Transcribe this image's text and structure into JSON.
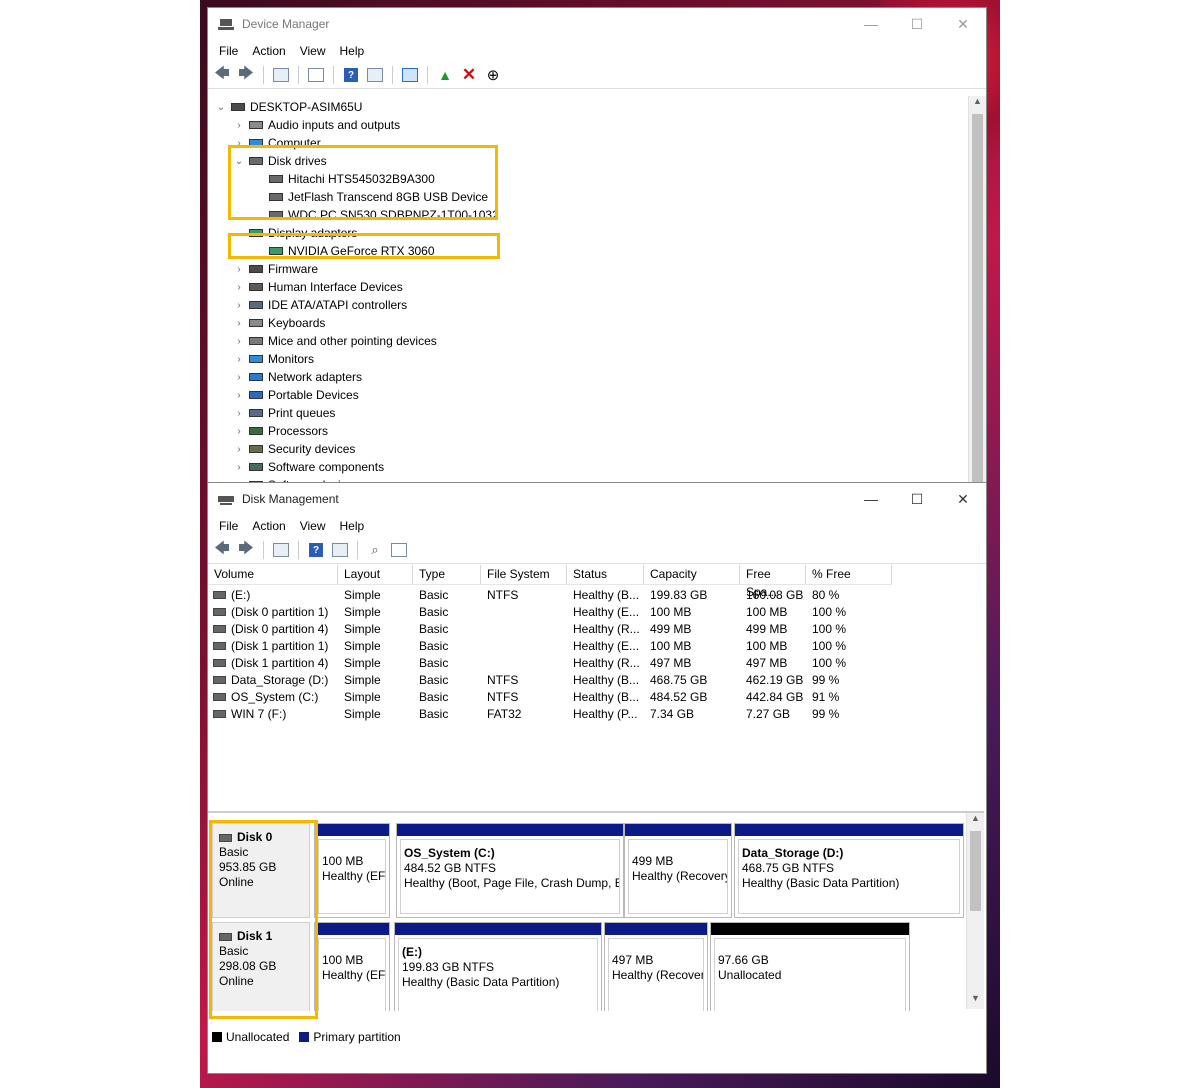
{
  "device_manager": {
    "title": "Device Manager",
    "menu": [
      "File",
      "Action",
      "View",
      "Help"
    ],
    "window_controls": {
      "minimize": "—",
      "maximize": "☐",
      "close": "✕"
    },
    "tree": [
      {
        "label": "DESKTOP-ASIM65U",
        "level": 0,
        "expander": "⌄",
        "icon": "computer-root-icon"
      },
      {
        "label": "Audio inputs and outputs",
        "level": 1,
        "expander": "›",
        "icon": "speaker-icon"
      },
      {
        "label": "Computer",
        "level": 1,
        "expander": "›",
        "icon": "monitor-icon"
      },
      {
        "label": "Disk drives",
        "level": 1,
        "expander": "⌄",
        "icon": "disk-drive-icon"
      },
      {
        "label": "Hitachi HTS545032B9A300",
        "level": 2,
        "expander": "",
        "icon": "disk-drive-icon"
      },
      {
        "label": "JetFlash Transcend 8GB USB Device",
        "level": 2,
        "expander": "",
        "icon": "disk-drive-icon"
      },
      {
        "label": "WDC PC SN530 SDBPNPZ-1T00-1032",
        "level": 2,
        "expander": "",
        "icon": "disk-drive-icon"
      },
      {
        "label": "Display adapters",
        "level": 1,
        "expander": "⌄",
        "icon": "display-adapter-icon"
      },
      {
        "label": "NVIDIA GeForce RTX 3060",
        "level": 2,
        "expander": "",
        "icon": "display-adapter-icon"
      },
      {
        "label": "Firmware",
        "level": 1,
        "expander": "›",
        "icon": "chip-icon"
      },
      {
        "label": "Human Interface Devices",
        "level": 1,
        "expander": "›",
        "icon": "hid-icon"
      },
      {
        "label": "IDE ATA/ATAPI controllers",
        "level": 1,
        "expander": "›",
        "icon": "ide-controller-icon"
      },
      {
        "label": "Keyboards",
        "level": 1,
        "expander": "›",
        "icon": "keyboard-icon"
      },
      {
        "label": "Mice and other pointing devices",
        "level": 1,
        "expander": "›",
        "icon": "mouse-icon"
      },
      {
        "label": "Monitors",
        "level": 1,
        "expander": "›",
        "icon": "monitor-icon"
      },
      {
        "label": "Network adapters",
        "level": 1,
        "expander": "›",
        "icon": "network-adapter-icon"
      },
      {
        "label": "Portable Devices",
        "level": 1,
        "expander": "›",
        "icon": "portable-device-icon"
      },
      {
        "label": "Print queues",
        "level": 1,
        "expander": "›",
        "icon": "printer-icon"
      },
      {
        "label": "Processors",
        "level": 1,
        "expander": "›",
        "icon": "processor-icon"
      },
      {
        "label": "Security devices",
        "level": 1,
        "expander": "›",
        "icon": "security-device-icon"
      },
      {
        "label": "Software components",
        "level": 1,
        "expander": "›",
        "icon": "software-component-icon"
      },
      {
        "label": "Software devices",
        "level": 1,
        "expander": "›",
        "icon": "software-device-icon"
      }
    ]
  },
  "disk_management": {
    "title": "Disk Management",
    "menu": [
      "File",
      "Action",
      "View",
      "Help"
    ],
    "window_controls": {
      "minimize": "—",
      "maximize": "☐",
      "close": "✕"
    },
    "columns": [
      "Volume",
      "Layout",
      "Type",
      "File System",
      "Status",
      "Capacity",
      "Free Spa...",
      "% Free"
    ],
    "volumes": [
      {
        "volume": "(E:)",
        "layout": "Simple",
        "type": "Basic",
        "fs": "NTFS",
        "status": "Healthy (B...",
        "capacity": "199.83 GB",
        "free": "160.08 GB",
        "pct": "80 %"
      },
      {
        "volume": "(Disk 0 partition 1)",
        "layout": "Simple",
        "type": "Basic",
        "fs": "",
        "status": "Healthy (E...",
        "capacity": "100 MB",
        "free": "100 MB",
        "pct": "100 %"
      },
      {
        "volume": "(Disk 0 partition 4)",
        "layout": "Simple",
        "type": "Basic",
        "fs": "",
        "status": "Healthy (R...",
        "capacity": "499 MB",
        "free": "499 MB",
        "pct": "100 %"
      },
      {
        "volume": "(Disk 1 partition 1)",
        "layout": "Simple",
        "type": "Basic",
        "fs": "",
        "status": "Healthy (E...",
        "capacity": "100 MB",
        "free": "100 MB",
        "pct": "100 %"
      },
      {
        "volume": "(Disk 1 partition 4)",
        "layout": "Simple",
        "type": "Basic",
        "fs": "",
        "status": "Healthy (R...",
        "capacity": "497 MB",
        "free": "497 MB",
        "pct": "100 %"
      },
      {
        "volume": "Data_Storage (D:)",
        "layout": "Simple",
        "type": "Basic",
        "fs": "NTFS",
        "status": "Healthy (B...",
        "capacity": "468.75 GB",
        "free": "462.19 GB",
        "pct": "99 %"
      },
      {
        "volume": "OS_System (C:)",
        "layout": "Simple",
        "type": "Basic",
        "fs": "NTFS",
        "status": "Healthy (B...",
        "capacity": "484.52 GB",
        "free": "442.84 GB",
        "pct": "91 %"
      },
      {
        "volume": "WIN 7 (F:)",
        "layout": "Simple",
        "type": "Basic",
        "fs": "FAT32",
        "status": "Healthy (P...",
        "capacity": "7.34 GB",
        "free": "7.27 GB",
        "pct": "99 %"
      }
    ],
    "disks": [
      {
        "name": "Disk 0",
        "type": "Basic",
        "size": "953.85 GB",
        "state": "Online",
        "partitions": [
          {
            "title": "",
            "line1": "100 MB",
            "line2": "Healthy (EFI",
            "kind": "primary"
          },
          {
            "title": "OS_System  (C:)",
            "line1": "484.52 GB NTFS",
            "line2": "Healthy (Boot, Page File, Crash Dump, Ba",
            "kind": "primary"
          },
          {
            "title": "",
            "line1": "499 MB",
            "line2": "Healthy (Recovery",
            "kind": "primary"
          },
          {
            "title": "Data_Storage  (D:)",
            "line1": "468.75 GB NTFS",
            "line2": "Healthy (Basic Data Partition)",
            "kind": "primary"
          }
        ]
      },
      {
        "name": "Disk 1",
        "type": "Basic",
        "size": "298.08 GB",
        "state": "Online",
        "partitions": [
          {
            "title": "",
            "line1": "100 MB",
            "line2": "Healthy (EFI",
            "kind": "primary"
          },
          {
            "title": "(E:)",
            "line1": "199.83 GB NTFS",
            "line2": "Healthy (Basic Data Partition)",
            "kind": "primary"
          },
          {
            "title": "",
            "line1": "497 MB",
            "line2": "Healthy (Recover",
            "kind": "primary"
          },
          {
            "title": "",
            "line1": "97.66 GB",
            "line2": "Unallocated",
            "kind": "unallocated"
          }
        ]
      }
    ],
    "legend": [
      {
        "label": "Unallocated",
        "color": "#000000"
      },
      {
        "label": "Primary partition",
        "color": "#0b1a85"
      }
    ]
  },
  "colors": {
    "highlight": "#f5b800",
    "primary_partition": "#0b1a85",
    "unallocated": "#000000"
  }
}
